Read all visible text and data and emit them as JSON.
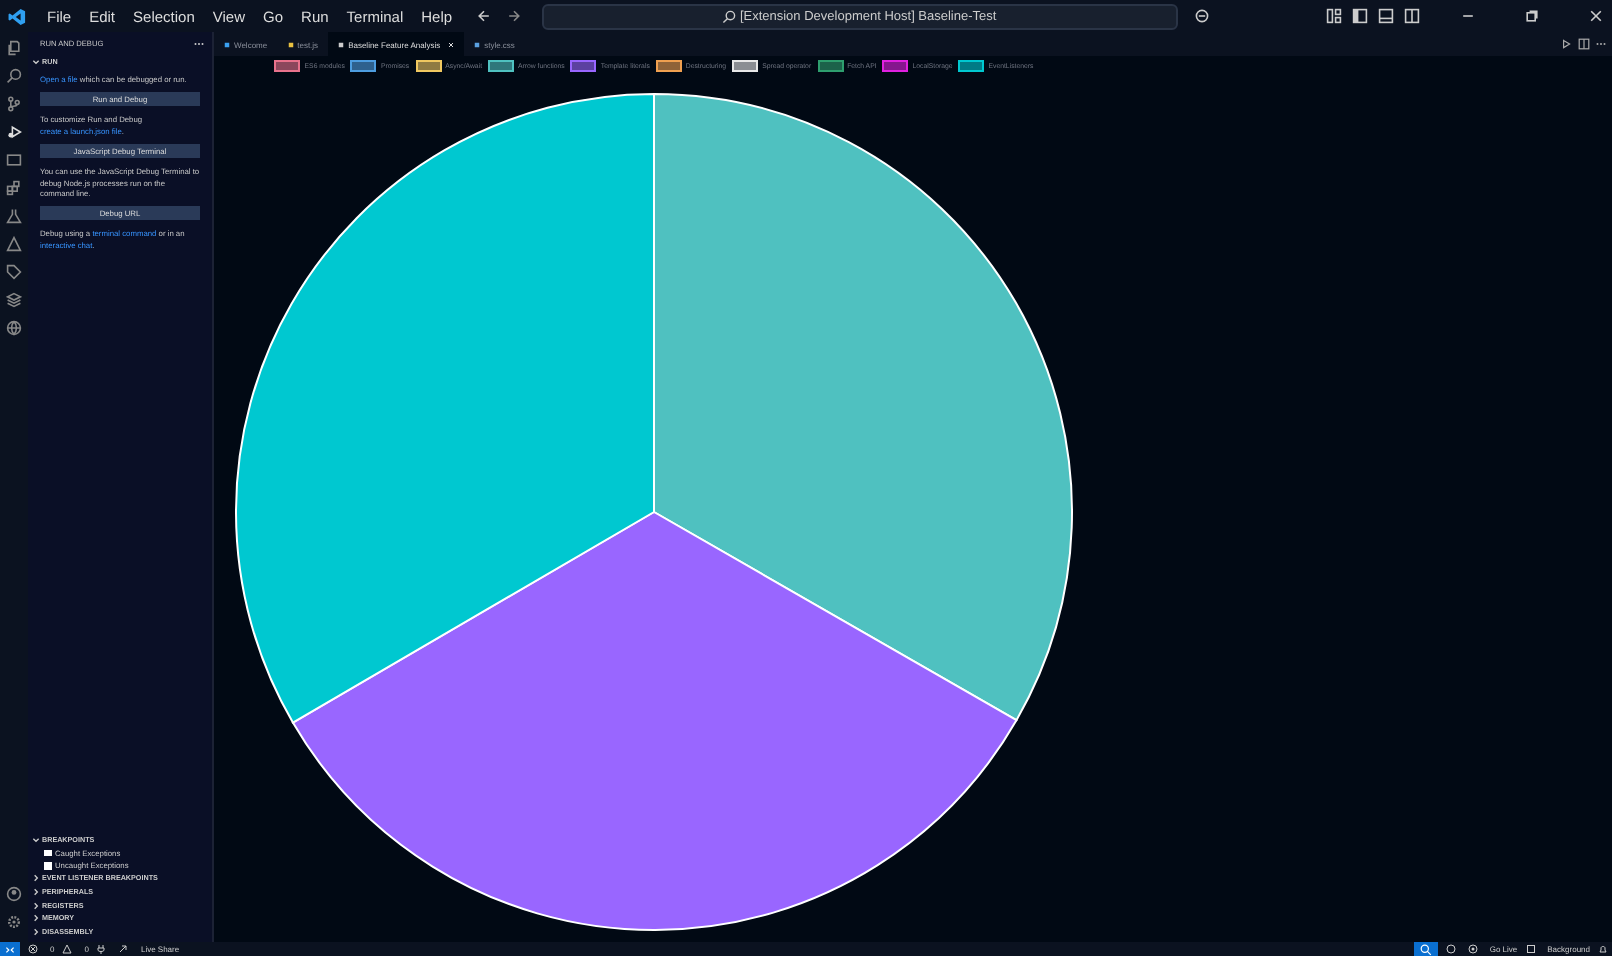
{
  "menu": [
    "File",
    "Edit",
    "Selection",
    "View",
    "Go",
    "Run",
    "Terminal",
    "Help"
  ],
  "command_center": "[Extension Development Host] Baseline-Test",
  "sidebar": {
    "title": "RUN AND DEBUG",
    "section": "RUN",
    "blocks": [
      {
        "kind": "text",
        "parts": [
          {
            "text": "Open a file",
            "link": true
          },
          {
            "text": " which can be debugged or run.",
            "link": false
          }
        ]
      },
      {
        "kind": "button",
        "label": "Run and Debug"
      },
      {
        "kind": "text",
        "parts": [
          {
            "text": "To customize Run and Debug ",
            "link": false
          },
          {
            "text": "create a launch.json file",
            "link": true
          },
          {
            "text": ".",
            "link": false
          }
        ]
      },
      {
        "kind": "button",
        "label": "JavaScript Debug Terminal"
      },
      {
        "kind": "text",
        "parts": [
          {
            "text": "You can use the JavaScript Debug Terminal to debug Node.js processes run on the command line.",
            "link": false
          }
        ]
      },
      {
        "kind": "button",
        "label": "Debug URL"
      },
      {
        "kind": "text",
        "parts": [
          {
            "text": "Debug using a ",
            "link": false
          },
          {
            "text": "terminal command",
            "link": true
          },
          {
            "text": " or in an ",
            "link": false
          },
          {
            "text": "interactive chat",
            "link": true
          },
          {
            "text": ".",
            "link": false
          }
        ]
      }
    ],
    "breakpoints": {
      "title": "BREAKPOINTS",
      "expanded": true,
      "items": [
        {
          "label": "Caught Exceptions",
          "checked": false
        },
        {
          "label": "Uncaught Exceptions",
          "checked": false
        }
      ]
    },
    "sections": [
      {
        "title": "EVENT LISTENER BREAKPOINTS",
        "expanded": false
      },
      {
        "title": "PERIPHERALS",
        "expanded": false
      },
      {
        "title": "REGISTERS",
        "expanded": false
      },
      {
        "title": "MEMORY",
        "expanded": false
      },
      {
        "title": "DISASSEMBLY",
        "expanded": false
      }
    ]
  },
  "tabs": [
    {
      "label": "Welcome",
      "selected": false
    },
    {
      "label": "test.js",
      "selected": false
    },
    {
      "label": "Baseline Feature Analysis",
      "selected": true
    },
    {
      "label": "style.css",
      "selected": false
    }
  ],
  "chart_data": {
    "type": "pie",
    "categories": [
      "ES6 modules",
      "Promises",
      "Async/Await",
      "Arrow functions",
      "Template literals",
      "Destructuring",
      "Spread operator",
      "Fetch API",
      "LocalStorage",
      "EventListeners"
    ],
    "values": [
      0,
      0,
      0,
      33.3,
      33.3,
      0,
      0,
      0,
      0,
      33.4
    ],
    "legend": true,
    "colors": [
      "#e8728c",
      "#4d9de0",
      "#f0c860",
      "#4fc1c0",
      "#9966ff",
      "#f0a050",
      "#e8e8e8",
      "#2e9e6e",
      "#e020e0",
      "#00c8d0"
    ]
  },
  "status_bar": {
    "errors": "0",
    "warnings": "0",
    "live_share": "Live Share",
    "go_live": "Go Live",
    "background": "Background"
  }
}
